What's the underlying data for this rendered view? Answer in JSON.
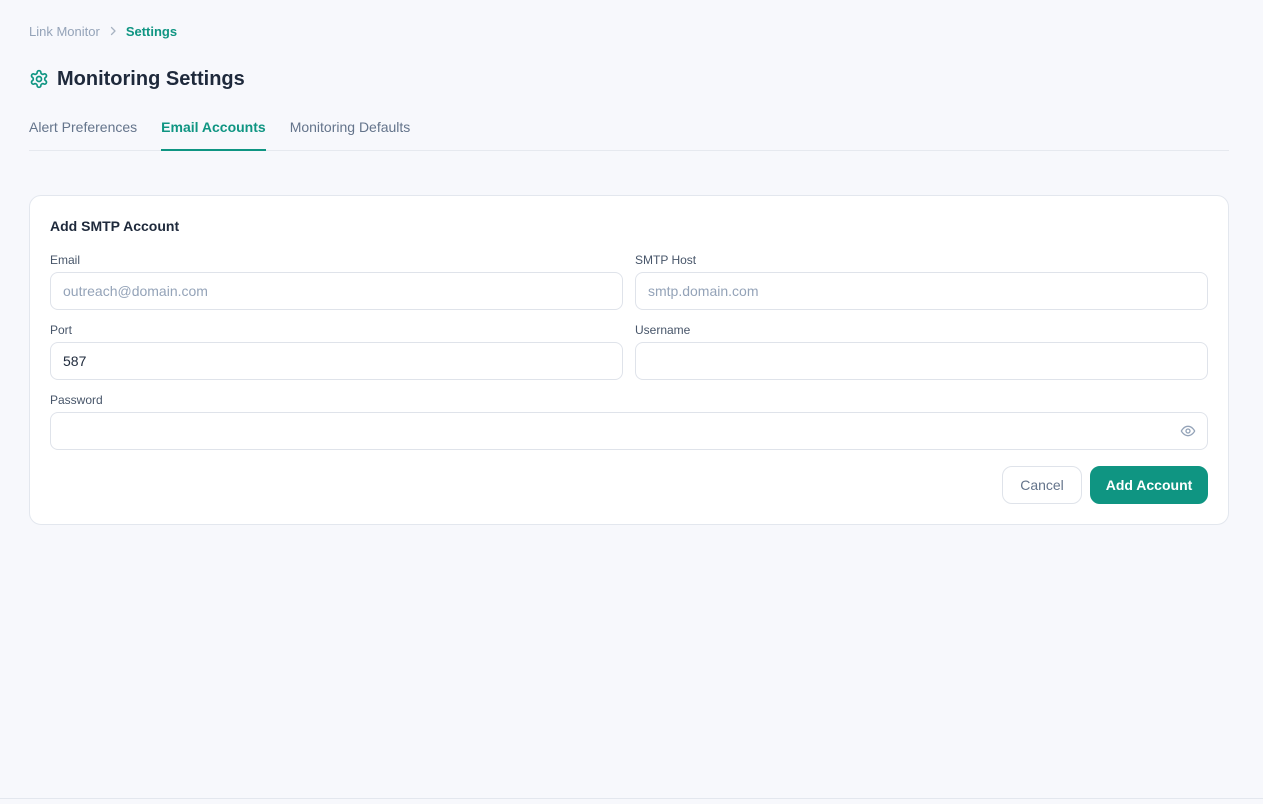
{
  "breadcrumb": {
    "parent": "Link Monitor",
    "current": "Settings"
  },
  "header": {
    "title": "Monitoring Settings",
    "icon": "gear-icon"
  },
  "tabs": [
    {
      "label": "Alert Preferences",
      "active": false
    },
    {
      "label": "Email Accounts",
      "active": true
    },
    {
      "label": "Monitoring Defaults",
      "active": false
    }
  ],
  "form": {
    "title": "Add SMTP Account",
    "email": {
      "label": "Email",
      "placeholder": "outreach@domain.com",
      "value": ""
    },
    "smtp_host": {
      "label": "SMTP Host",
      "placeholder": "smtp.domain.com",
      "value": ""
    },
    "port": {
      "label": "Port",
      "value": "587"
    },
    "username": {
      "label": "Username",
      "value": ""
    },
    "password": {
      "label": "Password",
      "value": "",
      "toggle_icon": "eye-icon"
    },
    "cancel_label": "Cancel",
    "submit_label": "Add Account"
  },
  "colors": {
    "accent": "#0f9582",
    "background": "#f7f8fc",
    "muted_text": "#64748b"
  }
}
